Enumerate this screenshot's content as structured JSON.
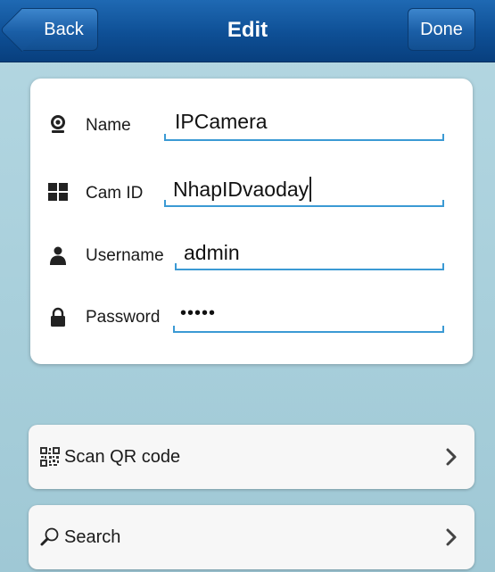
{
  "navbar": {
    "title": "Edit",
    "back_label": "Back",
    "done_label": "Done"
  },
  "form": {
    "fields": [
      {
        "label": "Name",
        "value": "IPCamera",
        "icon": "webcam-icon"
      },
      {
        "label": "Cam ID",
        "value": "NhapIDvaoday",
        "icon": "grid-icon"
      },
      {
        "label": "Username",
        "value": "admin",
        "icon": "user-icon"
      },
      {
        "label": "Password",
        "value": "•••••",
        "icon": "lock-icon"
      }
    ]
  },
  "actions": [
    {
      "label": "Scan QR code",
      "icon": "qr-code-icon"
    },
    {
      "label": "Search",
      "icon": "magnifier-icon"
    }
  ],
  "colors": {
    "navbar": "#0e4f95",
    "background": "#a8cfdb",
    "underline": "#3b9ad4"
  }
}
